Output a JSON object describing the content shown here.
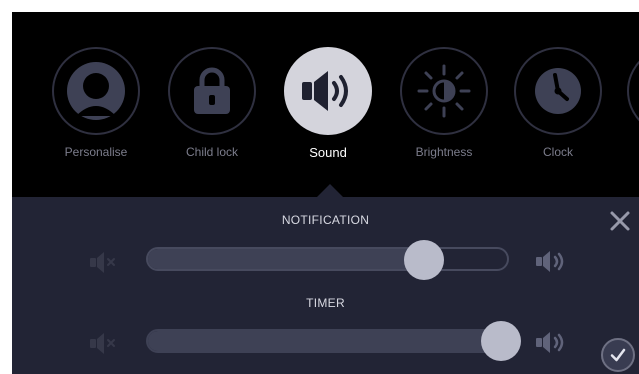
{
  "menu": {
    "items": [
      {
        "label": "Personalise",
        "icon": "person-icon",
        "active": false
      },
      {
        "label": "Child lock",
        "icon": "padlock-icon",
        "active": false
      },
      {
        "label": "Sound",
        "icon": "speaker-icon",
        "active": true
      },
      {
        "label": "Brightness",
        "icon": "brightness-icon",
        "active": false
      },
      {
        "label": "Clock",
        "icon": "clock-icon",
        "active": false
      }
    ]
  },
  "sound_panel": {
    "notification": {
      "title": "NOTIFICATION",
      "level": 0.8
    },
    "timer": {
      "title": "TIMER",
      "level": 1.0
    }
  },
  "colors": {
    "screen_bg": "#000000",
    "panel_bg": "#222435",
    "active_circle": "#d4d4dc",
    "knob": "#b9bbca"
  }
}
